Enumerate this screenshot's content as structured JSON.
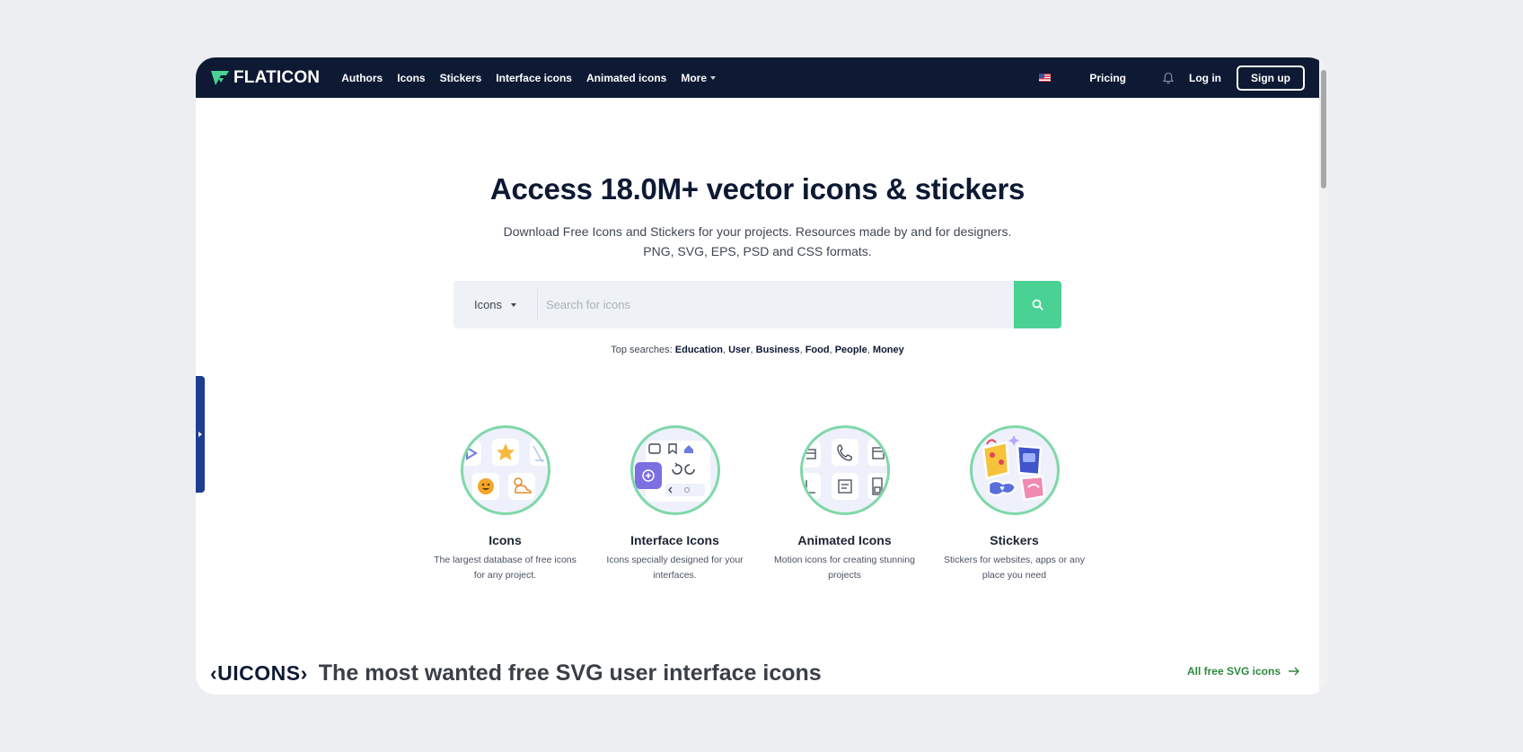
{
  "colors": {
    "nav_bg": "#0e1a34",
    "accent_green": "#4ad295",
    "link_green": "#2b8a3e",
    "side_tab": "#1e3d8f"
  },
  "nav": {
    "logo_text": "FLATICON",
    "links": [
      "Authors",
      "Icons",
      "Stickers",
      "Interface icons",
      "Animated icons",
      "More"
    ],
    "pricing": "Pricing",
    "login": "Log in",
    "signup": "Sign up",
    "icons": {
      "flag": "us-flag-icon",
      "bell": "bell-icon",
      "more": "chevron-down-icon"
    }
  },
  "hero": {
    "title": "Access 18.0M+ vector icons & stickers",
    "subtitle_line1": "Download Free Icons and Stickers for your projects. Resources made by and for designers.",
    "subtitle_line2": "PNG, SVG, EPS, PSD and CSS formats."
  },
  "search": {
    "type_selected": "Icons",
    "placeholder": "Search for icons",
    "value": "",
    "button_icon": "search-icon"
  },
  "top_searches": {
    "label": "Top searches:",
    "terms": [
      "Education",
      "User",
      "Business",
      "Food",
      "People",
      "Money"
    ]
  },
  "categories": [
    {
      "title": "Icons",
      "desc_line1": "The largest database of free icons",
      "desc_line2": "for any project."
    },
    {
      "title": "Interface Icons",
      "desc_line1": "Icons specially designed for your",
      "desc_line2": "interfaces."
    },
    {
      "title": "Animated Icons",
      "desc_line1": "Motion icons for creating stunning",
      "desc_line2": "projects"
    },
    {
      "title": "Stickers",
      "desc_line1": "Stickers for websites, apps or any",
      "desc_line2": "place you need"
    }
  ],
  "uicons": {
    "logo": "‹UICONS›",
    "title": "The most wanted free SVG user interface icons",
    "link": "All free SVG icons"
  }
}
